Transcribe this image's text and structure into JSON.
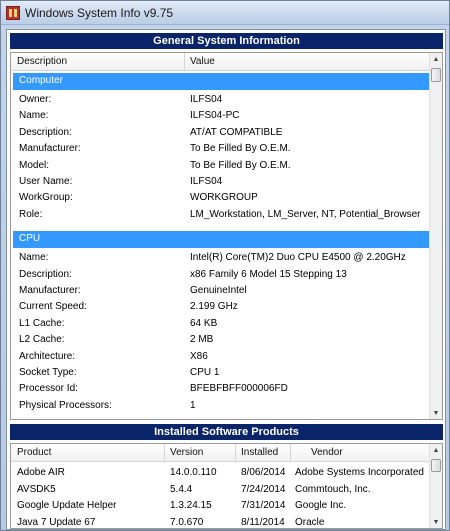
{
  "window": {
    "title": "Windows System Info  v9.75"
  },
  "general": {
    "header": "General System Information",
    "columns": [
      "Description",
      "Value"
    ],
    "groups": [
      {
        "name": "Computer",
        "rows": [
          [
            "Owner:",
            "ILFS04"
          ],
          [
            "Name:",
            "ILFS04-PC"
          ],
          [
            "Description:",
            "AT/AT COMPATIBLE"
          ],
          [
            "Manufacturer:",
            "To Be Filled By O.E.M."
          ],
          [
            "Model:",
            "To Be Filled By O.E.M."
          ],
          [
            "User Name:",
            "ILFS04"
          ],
          [
            "WorkGroup:",
            "WORKGROUP"
          ],
          [
            "Role:",
            "LM_Workstation, LM_Server, NT, Potential_Browser"
          ]
        ]
      },
      {
        "name": "CPU",
        "rows": [
          [
            "Name:",
            "Intel(R) Core(TM)2 Duo CPU     E4500  @ 2.20GHz"
          ],
          [
            "Description:",
            "x86 Family 6 Model 15 Stepping 13"
          ],
          [
            "Manufacturer:",
            "GenuineIntel"
          ],
          [
            "Current Speed:",
            "2.199 GHz"
          ],
          [
            "L1 Cache:",
            "64 KB"
          ],
          [
            "L2 Cache:",
            "2 MB"
          ],
          [
            "Architecture:",
            "X86"
          ],
          [
            "Socket Type:",
            "CPU 1"
          ],
          [
            "Processor Id:",
            "BFEBFBFF000006FD"
          ],
          [
            "Physical Processors:",
            "1"
          ]
        ]
      }
    ]
  },
  "software": {
    "header": "Installed Software Products",
    "columns": [
      "Product",
      "Version",
      "Installed",
      "Vendor"
    ],
    "rows": [
      [
        "Adobe AIR",
        "14.0.0.110",
        "8/06/2014",
        "Adobe Systems Incorporated"
      ],
      [
        "AVSDK5",
        "5.4.4",
        "7/24/2014",
        "Commtouch, Inc."
      ],
      [
        "Google Update Helper",
        "1.3.24.15",
        "7/31/2014",
        "Google Inc."
      ],
      [
        "Java 7 Update 67",
        "7.0.670",
        "8/11/2014",
        "Oracle"
      ]
    ]
  },
  "icons": {
    "app": "app-icon",
    "scroll_up": "scroll-up-icon",
    "scroll_down": "scroll-down-icon"
  }
}
